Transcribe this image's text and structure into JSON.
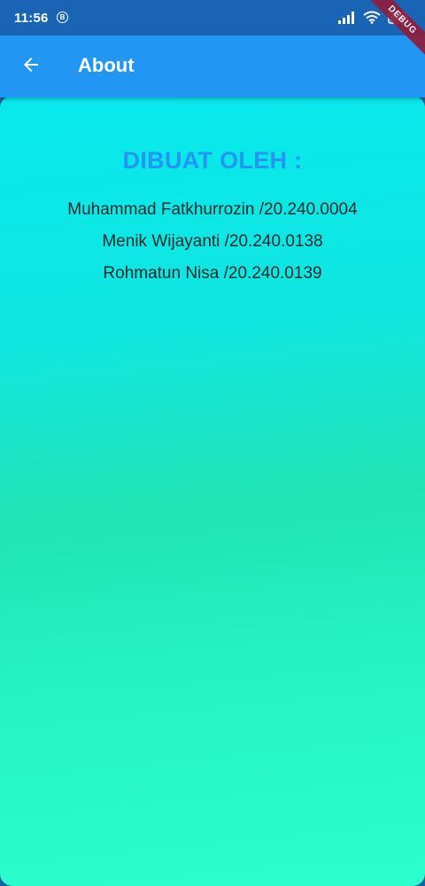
{
  "status_bar": {
    "time": "11:56",
    "b_badge": "B",
    "icons": [
      "signal-icon",
      "wifi-icon",
      "battery-icon"
    ]
  },
  "debug_banner": {
    "label": "DEBUG"
  },
  "app_bar": {
    "title": "About",
    "back_icon": "arrow-back-icon",
    "color": "#2196f3"
  },
  "content": {
    "heading": "DIBUAT OLEH :",
    "heading_color": "#2196f3",
    "credits": [
      "Muhammad Fatkhurrozin /20.240.0004",
      "Menik Wijayanti /20.240.0138",
      "Rohmatun Nisa /20.240.0139"
    ],
    "gradient_colors": [
      "#08e8ee",
      "#22e3b4",
      "#2bffcd"
    ]
  }
}
